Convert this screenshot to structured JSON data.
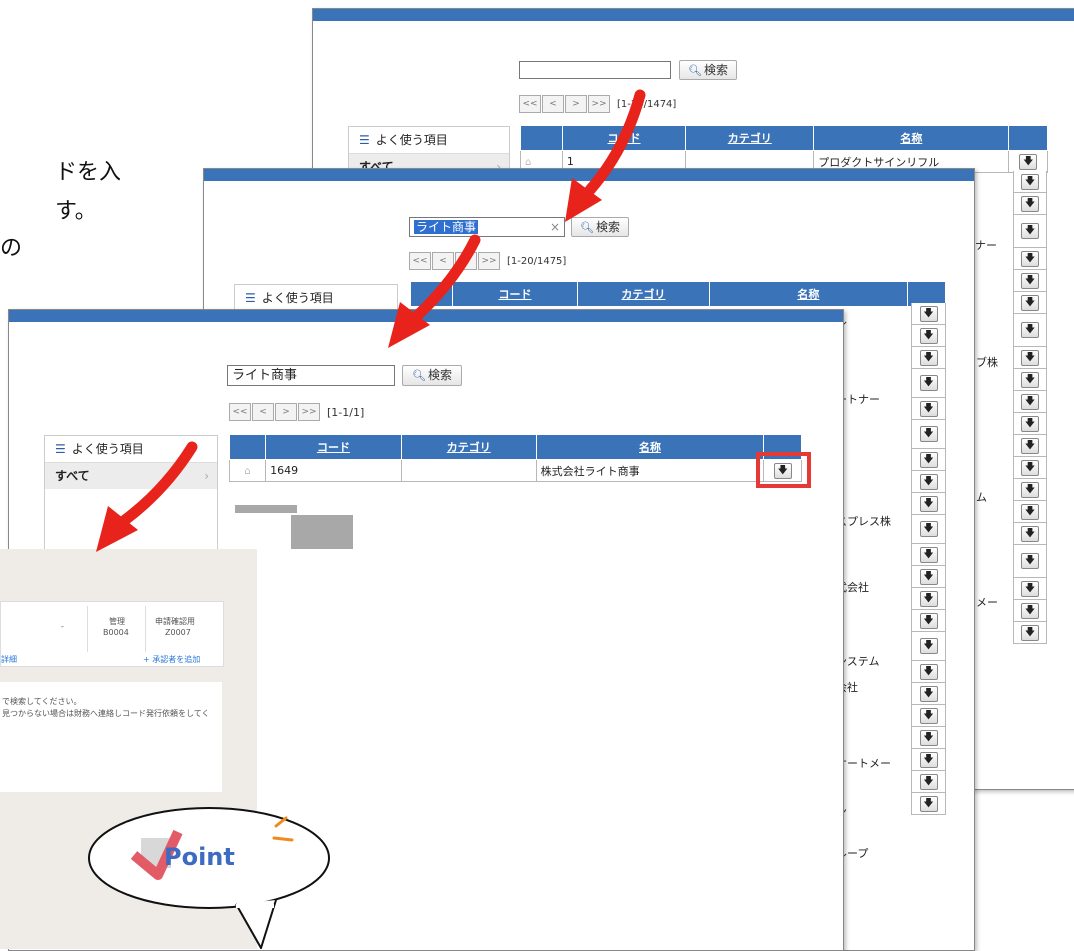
{
  "intro_text_fragments": [
    "ドを入",
    "す。",
    "の"
  ],
  "back_window": {
    "search_value": "",
    "search_button": "検索",
    "pager": [
      "<<",
      "<",
      ">",
      ">>"
    ],
    "range": "[1-20/1474]",
    "sidebar_fav": "よく使う項目",
    "sidebar_all": "すべて",
    "columns": [
      "コード",
      "カテゴリ",
      "名称"
    ],
    "first_code": "1",
    "right_fragments": [
      "プロダクトサインリフル",
      "ナー"
    ]
  },
  "middle_window": {
    "search_value": "ライト商事",
    "clear_mark": "×",
    "search_button": "検索",
    "pager": [
      "<<",
      "<",
      ">",
      ">>"
    ],
    "range": "[1-20/1475]",
    "sidebar_fav": "よく使う項目",
    "columns": [
      "コード",
      "カテゴリ",
      "名称"
    ],
    "right_fragments": [
      "ル",
      "ブ株",
      "ートナー",
      "ム",
      "スプレス株",
      "式会社",
      "メー",
      "ンステム",
      "会社",
      "サートメー",
      "ン",
      "ループ"
    ]
  },
  "front_window": {
    "search_value": "ライト商事",
    "search_button": "検索",
    "pager": [
      "<<",
      "<",
      ">",
      ">>"
    ],
    "range": "[1-1/1]",
    "sidebar_fav": "よく使う項目",
    "sidebar_all": "すべて",
    "columns": [
      "コード",
      "カテゴリ",
      "名称"
    ],
    "row": {
      "code": "1649",
      "category": "",
      "name": "株式会社ライト商事"
    }
  },
  "bottom_panel": {
    "dash": "-",
    "cell_a": [
      "管理",
      "B0004"
    ],
    "cell_b": [
      "申請確認用",
      "Z0007"
    ],
    "link_detail": "詳細",
    "link_add": "+ 承認者を追加",
    "note_line1": "で検索してください。",
    "note_line2": "見つからない場合は財務へ連絡しコード発行依頼をしてく"
  },
  "callout": {
    "label": "Point"
  },
  "colors": {
    "header_blue": "#3b73b9",
    "highlight_red": "#e53935",
    "arrow_red": "#e8231c"
  },
  "icons": {
    "download": "down-arrow-icon",
    "search": "search-icon",
    "pin": "pin-icon"
  }
}
